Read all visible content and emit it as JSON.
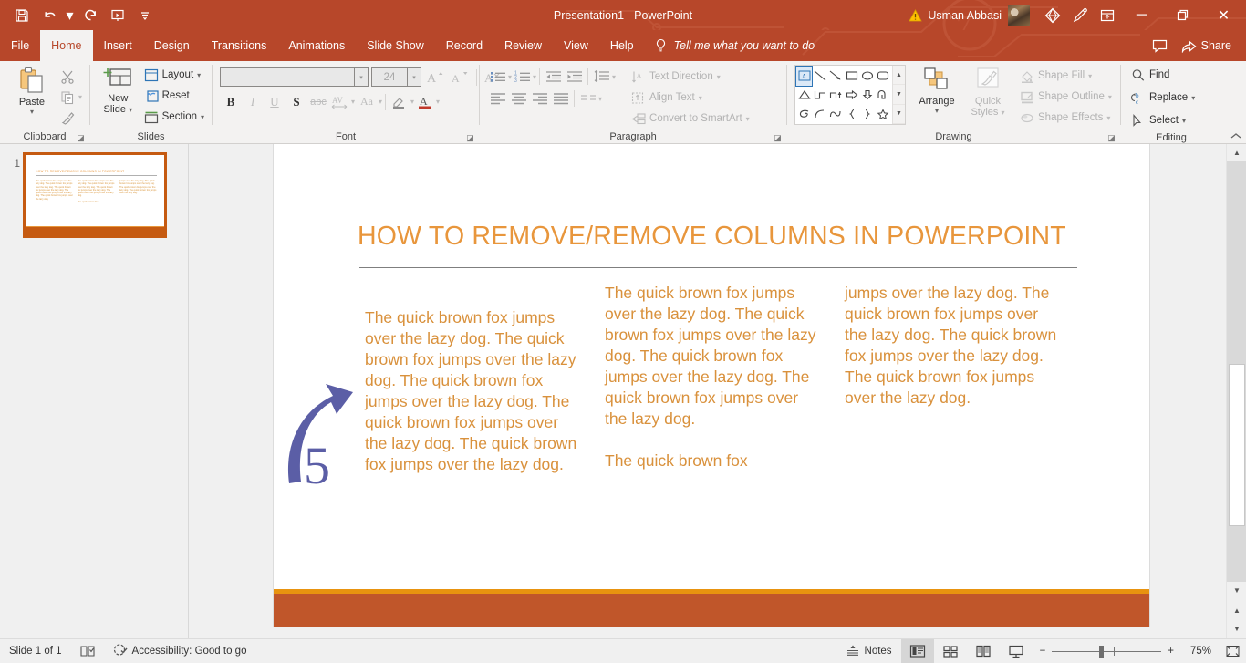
{
  "app": {
    "title": "Presentation1  -  PowerPoint",
    "user_name": "Usman Abbasi"
  },
  "quick_access": {
    "items": [
      {
        "name": "save-icon",
        "label": "Save"
      },
      {
        "name": "undo-icon",
        "label": "Undo"
      },
      {
        "name": "redo-icon",
        "label": "Redo"
      },
      {
        "name": "start-from-beginning-icon",
        "label": "Start From Beginning"
      },
      {
        "name": "customize-qat-icon",
        "label": "Customize Quick Access Toolbar"
      }
    ]
  },
  "titlebar_right": {
    "warning_icon": "warning-icon",
    "diamond_icon": "diamond-icon",
    "pen_icon": "pen-icon",
    "ribbon_display_icon": "ribbon-display-options-icon",
    "minimize": "─",
    "restore": "❐",
    "close": "✕"
  },
  "tabs": [
    {
      "label": "File",
      "active": false
    },
    {
      "label": "Home",
      "active": true
    },
    {
      "label": "Insert",
      "active": false
    },
    {
      "label": "Design",
      "active": false
    },
    {
      "label": "Transitions",
      "active": false
    },
    {
      "label": "Animations",
      "active": false
    },
    {
      "label": "Slide Show",
      "active": false
    },
    {
      "label": "Record",
      "active": false
    },
    {
      "label": "Review",
      "active": false
    },
    {
      "label": "View",
      "active": false
    },
    {
      "label": "Help",
      "active": false
    }
  ],
  "tell_me": {
    "placeholder": "Tell me what you want to do"
  },
  "share": {
    "label": "Share",
    "comments_icon": "comments-icon"
  },
  "ribbon": {
    "clipboard": {
      "label": "Clipboard",
      "paste": "Paste",
      "cut": "Cut",
      "copy": "Copy",
      "format_painter": "Format Painter"
    },
    "slides": {
      "label": "Slides",
      "new_slide": "New\nSlide",
      "new_slide_line1": "New",
      "new_slide_line2": "Slide",
      "layout": "Layout",
      "reset": "Reset",
      "section": "Section"
    },
    "font": {
      "label": "Font",
      "font_name_value": "",
      "font_name_placeholder": "",
      "font_size_value": "24",
      "grow_font": "A",
      "shrink_font": "A",
      "clear_formatting": "Clear All Formatting",
      "bold": "B",
      "italic": "I",
      "underline": "U",
      "shadow": "S",
      "strikethrough": "abc",
      "character_spacing": "AV",
      "change_case": "Aa",
      "text_highlight": "text-highlight-icon",
      "font_color": "A"
    },
    "paragraph": {
      "label": "Paragraph",
      "bullets": "Bullets",
      "numbering": "Numbering",
      "decrease_indent": "Decrease List Level",
      "increase_indent": "Increase List Level",
      "line_spacing": "Line Spacing",
      "align_left": "Align Left",
      "align_center": "Center",
      "align_right": "Align Right",
      "justify": "Justify",
      "columns": "Columns",
      "text_direction": "Text Direction",
      "align_text": "Align Text",
      "convert_smartart": "Convert to SmartArt"
    },
    "drawing": {
      "label": "Drawing",
      "arrange": "Arrange",
      "quick_styles_line1": "Quick",
      "quick_styles_line2": "Styles",
      "shape_fill": "Shape Fill",
      "shape_outline": "Shape Outline",
      "shape_effects": "Shape Effects"
    },
    "editing": {
      "label": "Editing",
      "find": "Find",
      "replace": "Replace",
      "select": "Select"
    }
  },
  "thumbnail": {
    "number": "1",
    "title": "HOW TO  REMOVE/REMOVE COLUMNS IN POWERPOINT",
    "col1": "The quick brown fox jumps over the lazy dog. The quick brown fox jumps over the lazy dog. The quick brown fox jumps over the lazy dog. The quick brown fox jumps over the lazy dog. The quick brown fox jumps over the lazy dog.",
    "col2": "The quick brown fox jumps over the lazy dog. The quick brown fox jumps over the lazy dog. The quick brown fox jumps over the lazy dog. The quick brown fox jumps over the lazy dog.",
    "col2b": "The quick brown fox",
    "col3": "jumps over the lazy dog. The quick brown fox jumps over the lazy dog. The quick brown fox jumps over the lazy dog. The quick brown fox jumps over the lazy dog."
  },
  "slide": {
    "title": "HOW TO  REMOVE/REMOVE COLUMNS IN POWERPOINT",
    "title_color": "#e8963c",
    "body_color": "#d9913c",
    "accent_bar_color": "#c0562a",
    "accent_stripe_color": "#e8930f",
    "columns": [
      {
        "paragraphs": [
          "The quick brown fox jumps over the lazy dog. The quick brown fox jumps over the lazy dog. The quick brown fox jumps over the lazy dog. The quick brown fox jumps over the lazy dog. The quick brown fox jumps over the lazy dog."
        ]
      },
      {
        "paragraphs": [
          "The quick brown fox jumps over the lazy dog. The quick brown fox jumps over the lazy dog. The quick brown fox jumps over the lazy dog. The quick brown fox jumps over the lazy dog.",
          "The quick brown fox"
        ]
      },
      {
        "paragraphs": [
          "jumps over the lazy dog. The quick brown fox jumps over the lazy dog. The quick brown fox jumps over the lazy dog. The quick brown fox jumps over the lazy dog."
        ]
      }
    ],
    "annotation": {
      "number": "5",
      "color": "#5b5ea6",
      "icon": "curved-arrow-icon"
    }
  },
  "status": {
    "slide_count": "Slide 1 of 1",
    "language_icon": "language-icon",
    "accessibility": "Accessibility: Good to go",
    "notes": "Notes",
    "views": [
      {
        "name": "normal-view",
        "active": true
      },
      {
        "name": "slide-sorter-view",
        "active": false
      },
      {
        "name": "reading-view",
        "active": false
      },
      {
        "name": "slide-show-view",
        "active": false
      }
    ],
    "zoom_out": "−",
    "zoom_in": "+",
    "zoom_level": "75%",
    "fit_to_window": "fit-slide-to-window-icon"
  }
}
